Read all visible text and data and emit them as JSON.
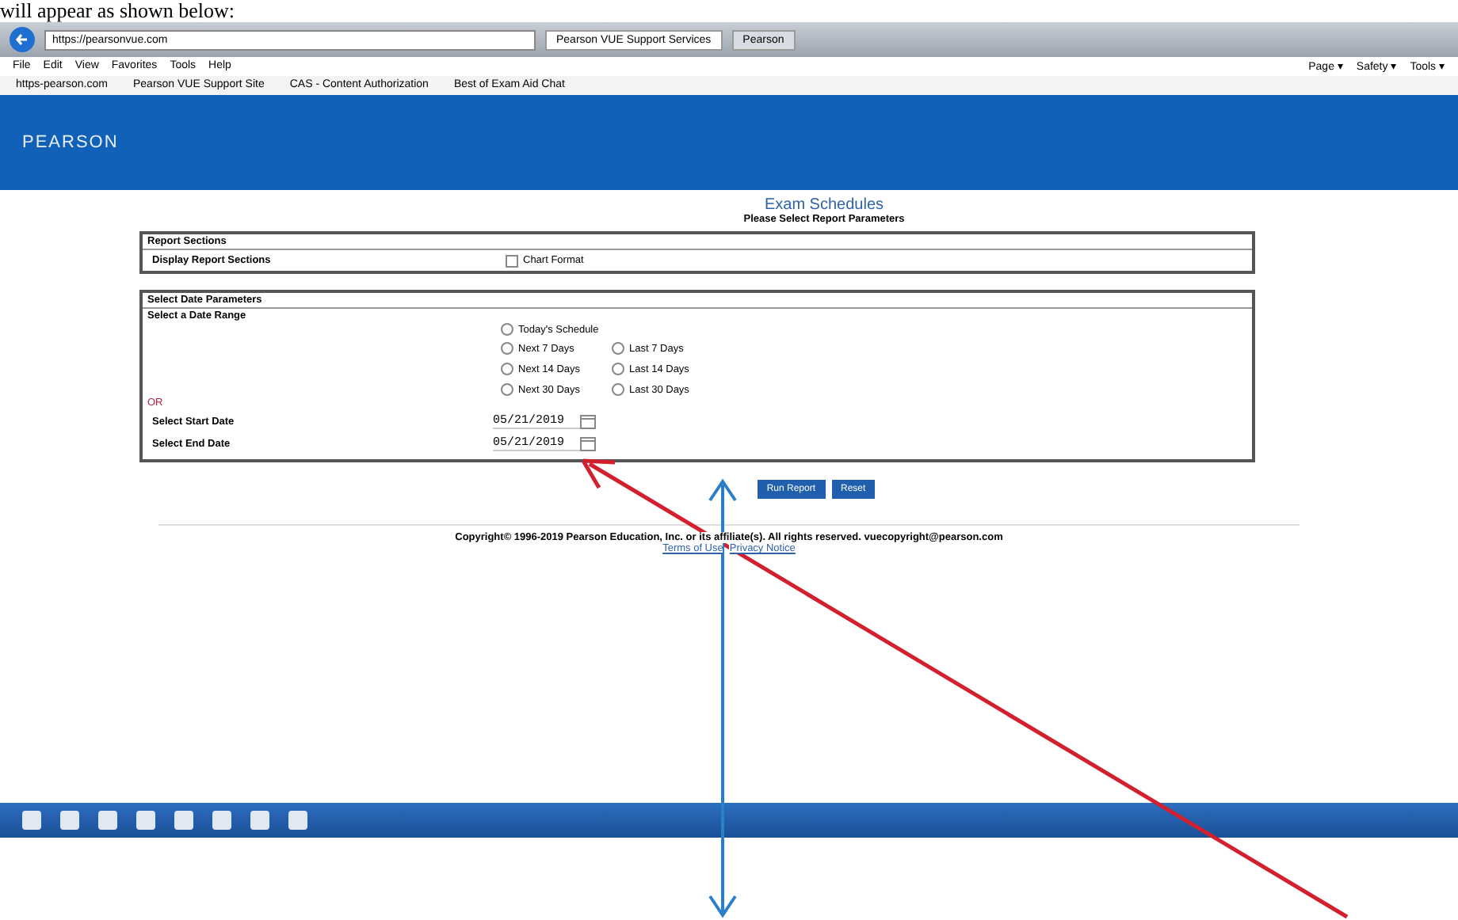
{
  "caption": "will appear as shown below:",
  "browser": {
    "address": "https://pearsonvue.com",
    "tabs": [
      {
        "label": "Pearson VUE Support Services",
        "selected": true
      },
      {
        "label": "Pearson",
        "selected": false
      }
    ],
    "menu": [
      "File",
      "Edit",
      "View",
      "Favorites",
      "Tools",
      "Help"
    ],
    "favorites": [
      "https-pearson.com",
      "Pearson VUE Support Site",
      "CAS - Content Authorization",
      "Best of Exam Aid Chat"
    ],
    "commands": [
      "Page ▾",
      "Safety ▾",
      "Tools ▾"
    ]
  },
  "header": {
    "logo": "PEARSON"
  },
  "page": {
    "title": "Exam Schedules",
    "subtitle": "Please Select Report Parameters"
  },
  "report_sections": {
    "heading": "Report Sections",
    "label": "Display Report Sections",
    "option": {
      "label": "Chart Format",
      "checked": false
    }
  },
  "date_parameters": {
    "heading": "Select Date Parameters",
    "range_label": "Select a Date Range",
    "today": {
      "label": "Today's Schedule",
      "selected": false
    },
    "ranges": [
      {
        "label": "Next 7 Days",
        "selected": false
      },
      {
        "label": "Last 7 Days",
        "selected": false
      },
      {
        "label": "Next 14 Days",
        "selected": false
      },
      {
        "label": "Last 14 Days",
        "selected": false
      },
      {
        "label": "Next 30 Days",
        "selected": false
      },
      {
        "label": "Last 30 Days",
        "selected": false
      }
    ],
    "or_label": "OR",
    "start_label": "Select Start Date",
    "start_value": "05/21/2019",
    "end_label": "Select End Date",
    "end_value": "05/21/2019"
  },
  "buttons": [
    "Run Report",
    "Reset"
  ],
  "footer": {
    "copyright": "Copyright© 1996-2019 Pearson Education, Inc. or its affiliate(s). All rights reserved. vuecopyright@pearson.com",
    "links": [
      "Terms of Use",
      "Privacy Notice"
    ]
  }
}
